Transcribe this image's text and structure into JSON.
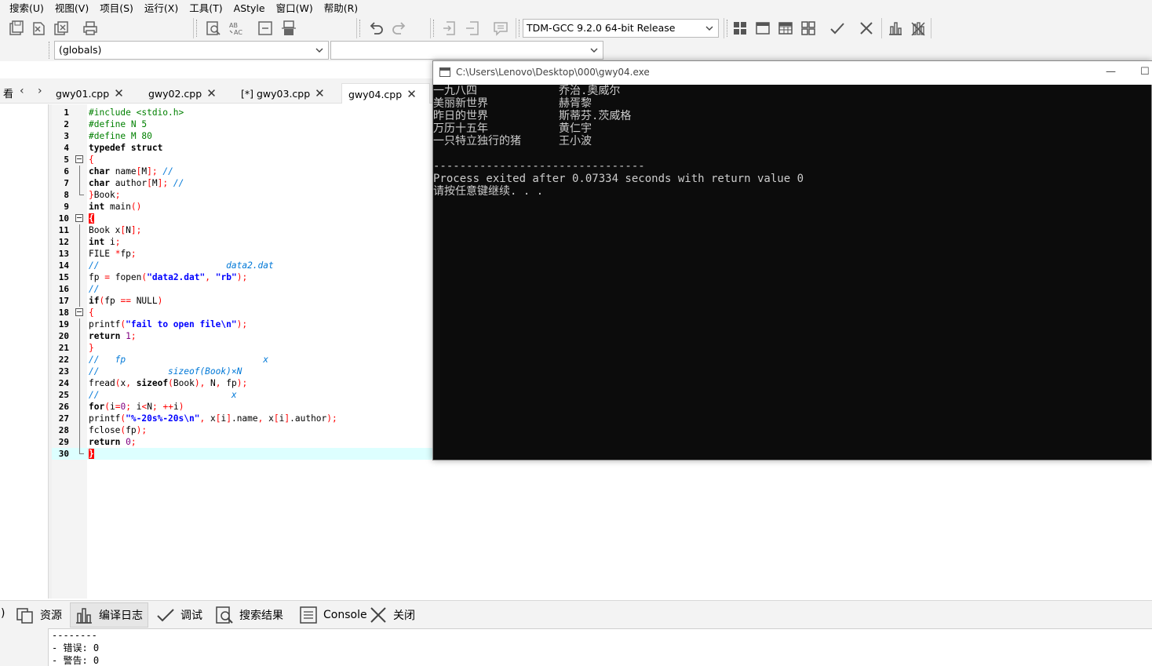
{
  "menu": [
    "搜索(U)",
    "视图(V)",
    "项目(S)",
    "运行(X)",
    "工具(T)",
    "AStyle",
    "窗口(W)",
    "帮助(R)"
  ],
  "toolbar": {
    "compiler": "TDM-GCC 9.2.0 64-bit Release",
    "icons": [
      "save-all-icon",
      "close-file-icon",
      "close-all-icon",
      "print-icon",
      "find-icon",
      "replace-icon",
      "indent-icon",
      "unindent-icon",
      "undo-icon",
      "redo-icon",
      "goto-icon",
      "bookmark-icon",
      "comment-icon",
      "grid-icon",
      "window-icon",
      "table-icon",
      "tiles-icon",
      "check-icon",
      "cross-icon",
      "chart-icon",
      "chart-cancel-icon"
    ]
  },
  "scope": {
    "globals": "(globals)",
    "member": ""
  },
  "tabs_row": {
    "left_label": "看",
    "prev": "‹",
    "next": "›",
    "tabs": [
      {
        "label": "gwy01.cpp",
        "close": "✕"
      },
      {
        "label": "gwy02.cpp",
        "close": "✕"
      },
      {
        "label": "[*] gwy03.cpp",
        "close": "✕"
      },
      {
        "label": "gwy04.cpp",
        "close": "✕"
      }
    ]
  },
  "code_lines": [
    "#include <stdio.h>",
    "#define N 5",
    "#define M 80",
    "typedef struct",
    "{",
    "char name[M]; //",
    "char author[M]; //",
    "}Book;",
    "int main()",
    "{",
    "Book x[N];",
    "int i;",
    "FILE *fp;",
    "//                        data2.dat",
    "fp = fopen(\"data2.dat\", \"rb\");",
    "//",
    "if(fp == NULL)",
    "{",
    "printf(\"fail to open file\\n\");",
    "return 1;",
    "}",
    "//   fp                          x",
    "//             sizeof(Book)×N",
    "fread(x, sizeof(Book), N, fp);",
    "//                         x",
    "for(i=0; i<N; ++i)",
    "printf(\"%-20s%-20s\\n\", x[i].name, x[i].author);",
    "fclose(fp);",
    "return 0;",
    "}"
  ],
  "console": {
    "title": "C:\\Users\\Lenovo\\Desktop\\000\\gwy04.exe",
    "minimize": "—",
    "maximize": "☐",
    "rows": [
      {
        "name": "一九八四",
        "author": "乔治.奥威尔"
      },
      {
        "name": "美丽新世界",
        "author": "赫胥黎"
      },
      {
        "name": "昨日的世界",
        "author": "斯蒂芬.茨威格"
      },
      {
        "name": "万历十五年",
        "author": "黄仁宇"
      },
      {
        "name": "一只特立独行的猪",
        "author": "王小波"
      }
    ],
    "separator": "--------------------------------",
    "exit_message": "Process exited after 0.07334 seconds with return value 0",
    "press_key": "请按任意键继续. . ."
  },
  "bottom_tabs": [
    {
      "label": "资源",
      "icon": "resources-icon"
    },
    {
      "label": "编译日志",
      "icon": "compile-log-icon"
    },
    {
      "label": "调试",
      "icon": "debug-icon"
    },
    {
      "label": "搜索结果",
      "icon": "search-results-icon"
    },
    {
      "label": "Console",
      "icon": "console-icon"
    },
    {
      "label": "关闭",
      "icon": "close-icon"
    }
  ],
  "bottom_left_mark": ")",
  "log": [
    "--------",
    "- 错误: 0",
    "- 警告: 0"
  ]
}
